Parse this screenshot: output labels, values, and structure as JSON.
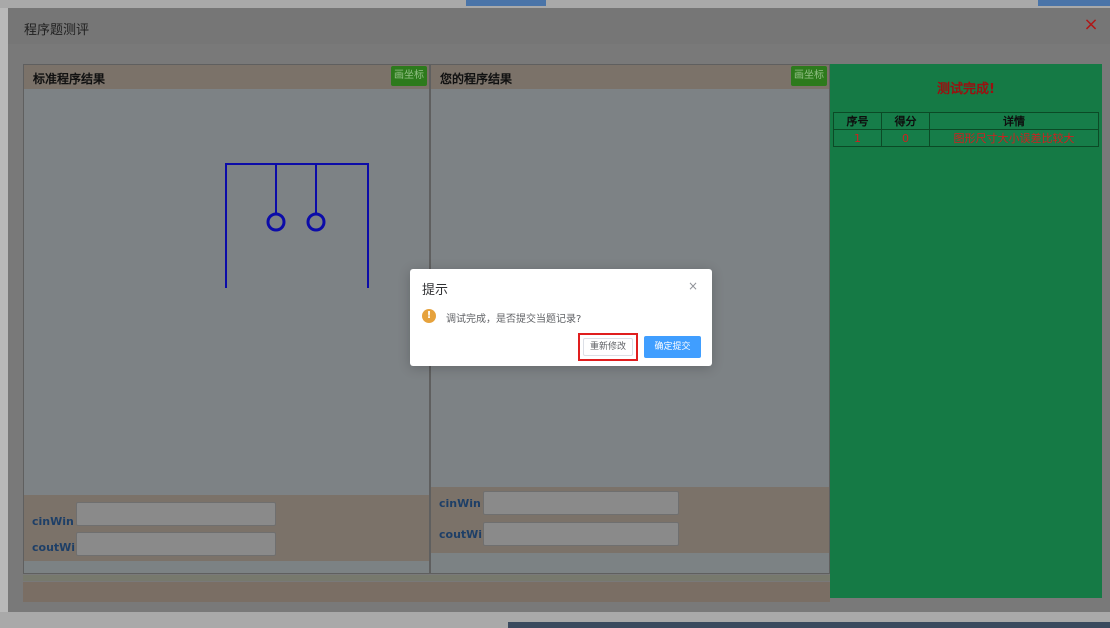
{
  "dialog": {
    "title": "程序题测评",
    "close_icon": "×"
  },
  "standard_pane": {
    "title": "标准程序结果",
    "axis_button": "画坐标",
    "cin_label": "cinWin",
    "cout_label": "coutWin"
  },
  "user_pane": {
    "title": "您的程序结果",
    "axis_button": "画坐标",
    "cin_label": "cinWin",
    "cout_label": "coutWin"
  },
  "result": {
    "title": "测试完成!",
    "headers": [
      "序号",
      "得分",
      "详情"
    ],
    "rows": [
      {
        "index": "1",
        "score": "0",
        "detail": "图形尺寸大小误差比较大"
      }
    ]
  },
  "prompt": {
    "title": "提示",
    "close_icon": "×",
    "icon": "!",
    "message": "调试完成，是否提交当题记录?",
    "redo_button": "重新修改",
    "submit_button": "确定提交"
  },
  "colors": {
    "figure_stroke": "#0c0ca8",
    "result_bg": "#157a45",
    "result_title": "#9a1010",
    "primary_button": "#409eff",
    "highlight_box": "#e01e1e",
    "warning_icon": "#e6a23c"
  }
}
